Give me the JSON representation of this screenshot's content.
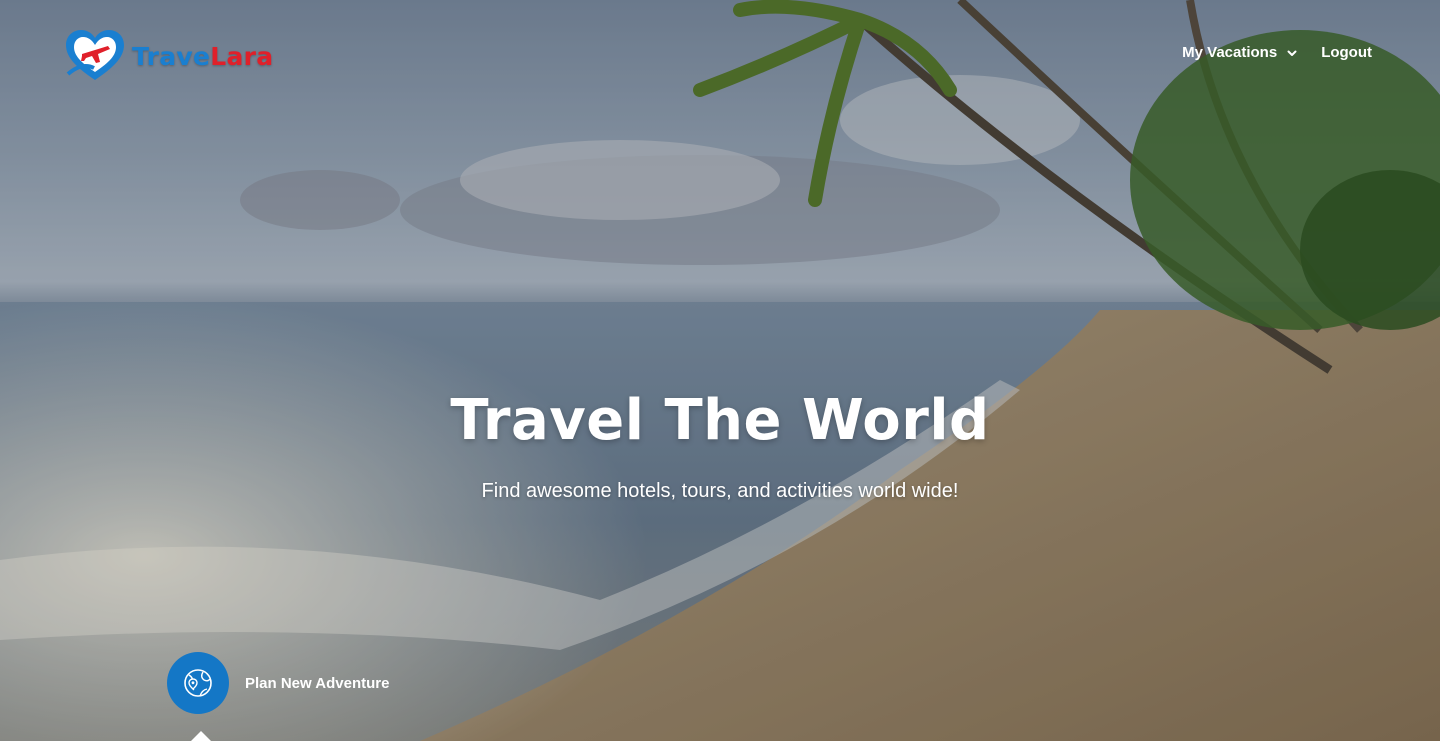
{
  "brand": {
    "name_part1": "Trave",
    "name_part2": "Lara",
    "logo_icon": "heart-plane-logo"
  },
  "nav": {
    "vacations_label": "My Vacations",
    "vacations_icon": "chevron-down-icon",
    "logout_label": "Logout"
  },
  "hero": {
    "title": "Travel The World",
    "subtitle": "Find awesome hotels, tours, and activities world wide!"
  },
  "cta": {
    "label": "Plan New Adventure",
    "icon": "globe-pin-icon"
  },
  "colors": {
    "brand_blue": "#1477c6",
    "brand_red": "#e0202a",
    "text": "#ffffff"
  }
}
